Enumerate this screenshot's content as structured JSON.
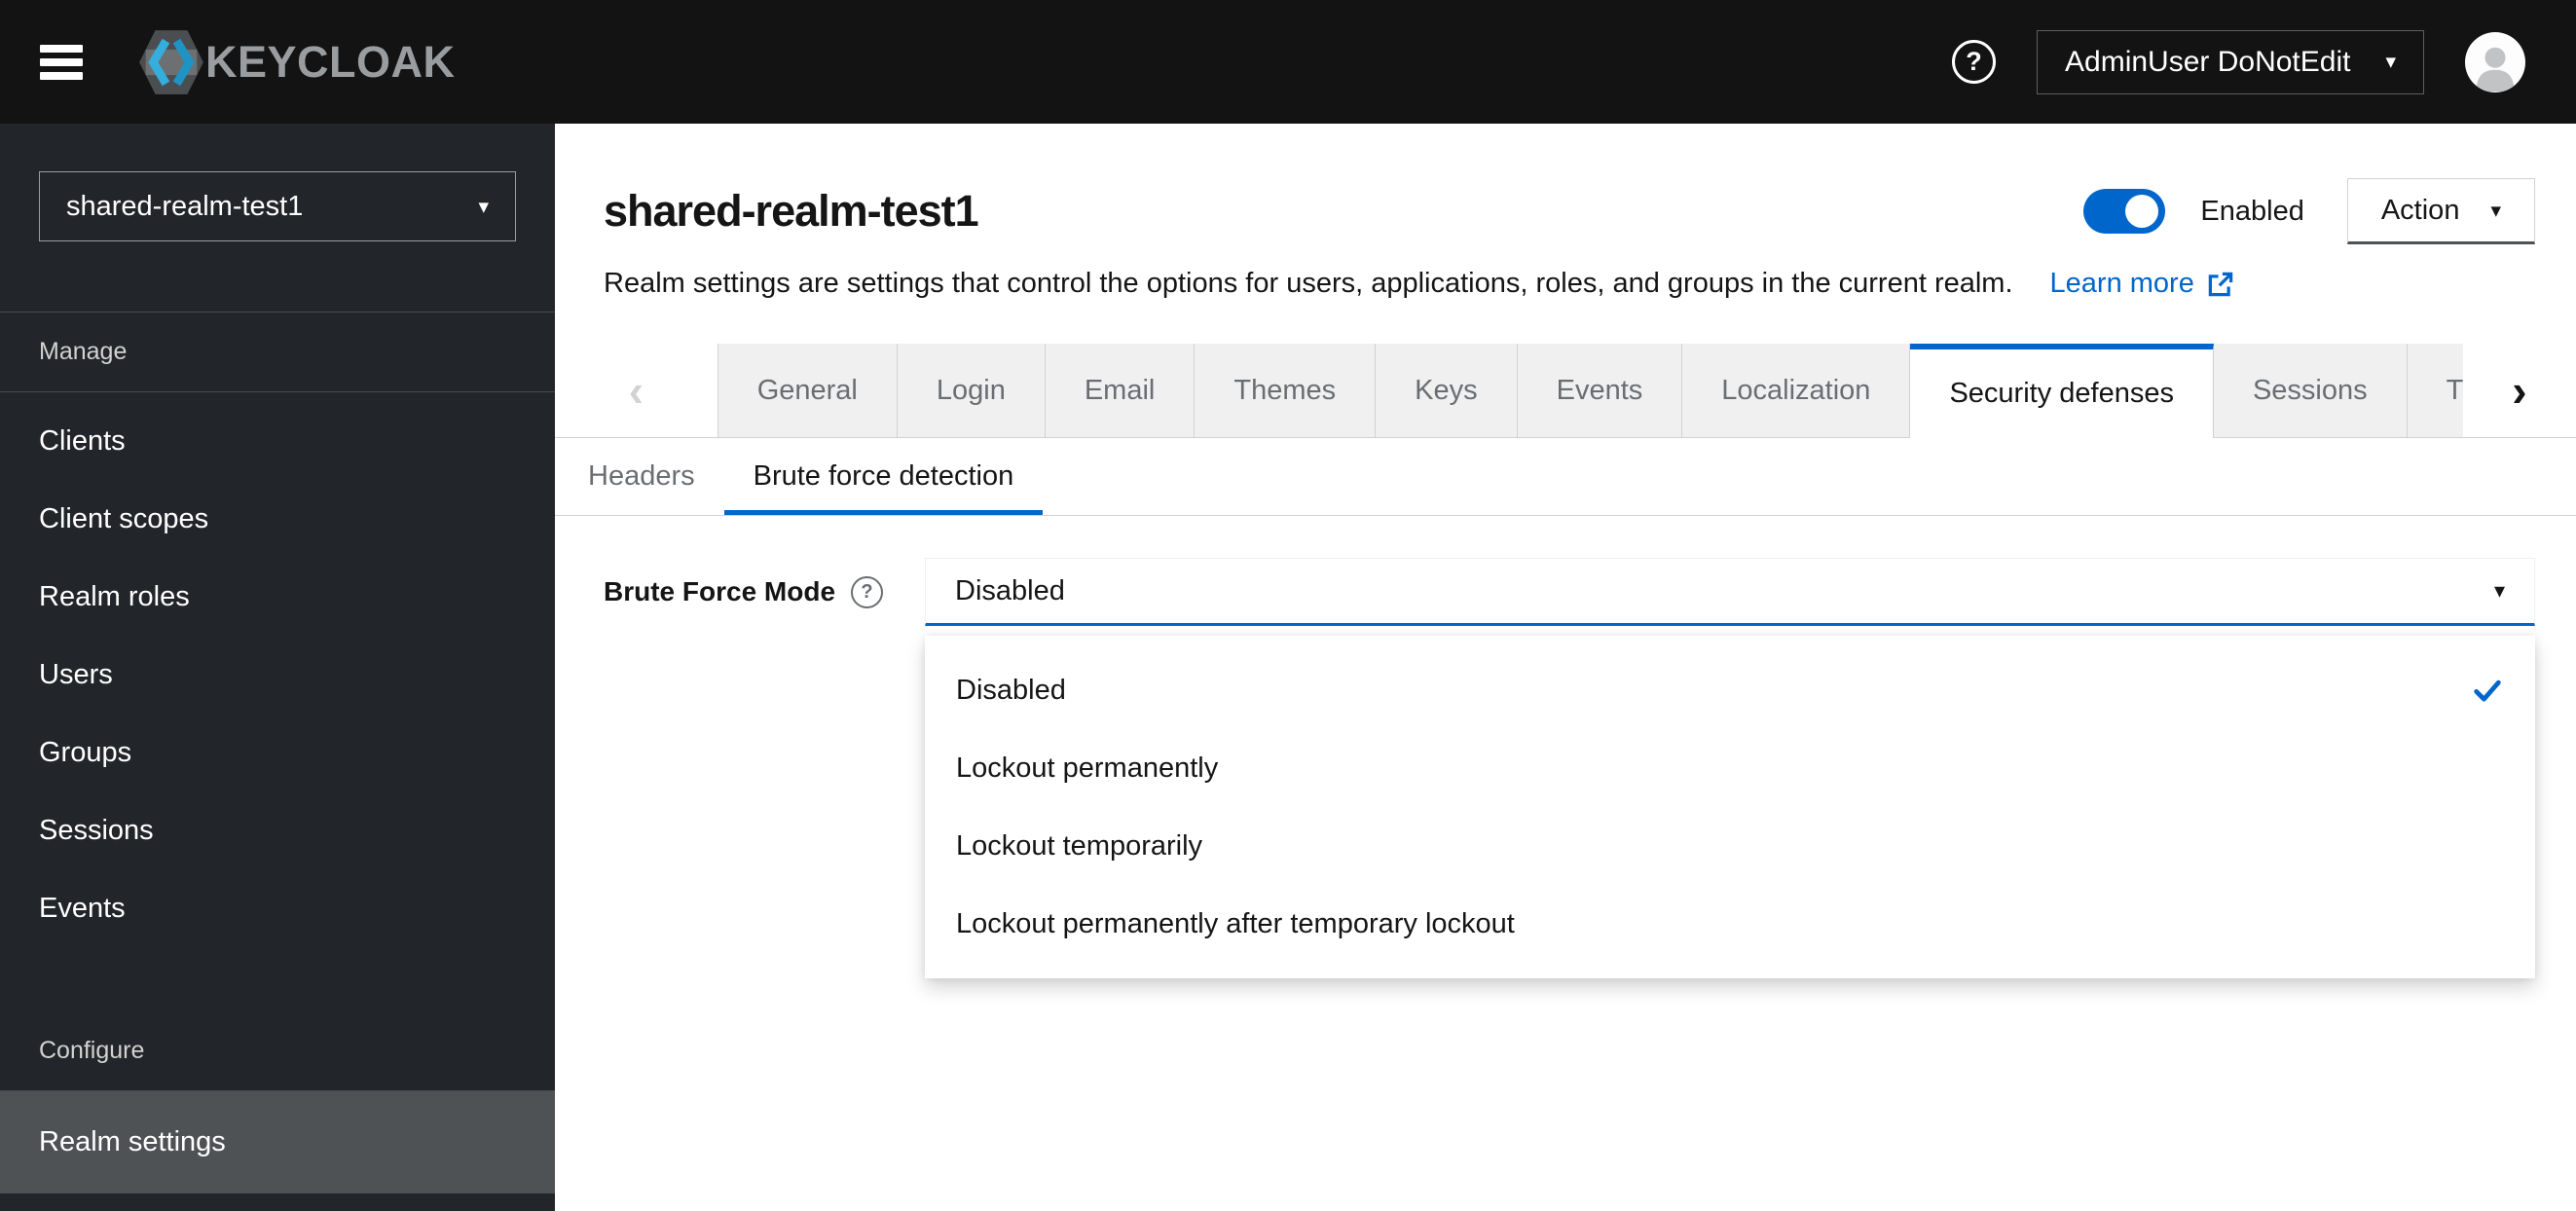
{
  "colors": {
    "accent_blue": "#0066cc",
    "masthead_bg": "#131313",
    "sidebar_bg": "#222529",
    "sidebar_active_bg": "#4f5255",
    "tab_inactive_bg": "#f0f0f0",
    "border_gray": "#d2d2d2",
    "muted_text": "#6a6e73"
  },
  "masthead": {
    "brand_text": "KEYCLOAK",
    "help_glyph": "?",
    "username": "AdminUser DoNotEdit",
    "caret_glyph": "▾"
  },
  "sidebar": {
    "realm_selector_value": "shared-realm-test1",
    "caret_glyph": "▾",
    "sections": [
      {
        "label": "Manage",
        "items": [
          "Clients",
          "Client scopes",
          "Realm roles",
          "Users",
          "Groups",
          "Sessions",
          "Events"
        ]
      },
      {
        "label": "Configure",
        "items": [
          "Realm settings"
        ]
      }
    ],
    "active_item": "Realm settings"
  },
  "page_header": {
    "title": "shared-realm-test1",
    "toggle_state": "on",
    "toggle_label": "Enabled",
    "action_label": "Action",
    "action_caret": "▾",
    "description": "Realm settings are settings that control the options for users, applications, roles, and groups in the current realm.",
    "learn_more_label": "Learn more"
  },
  "tabs": {
    "scroll_left_glyph": "‹",
    "scroll_right_glyph": "›",
    "labels": [
      "General",
      "Login",
      "Email",
      "Themes",
      "Keys",
      "Events",
      "Localization",
      "Security defenses",
      "Sessions"
    ],
    "partial_label": "T",
    "active": "Security defenses"
  },
  "subtabs": {
    "labels": [
      "Headers",
      "Brute force detection"
    ],
    "active": "Brute force detection"
  },
  "form": {
    "field_label": "Brute Force Mode",
    "help_glyph": "?",
    "select_value": "Disabled",
    "caret_glyph": "▾",
    "options": [
      "Disabled",
      "Lockout permanently",
      "Lockout temporarily",
      "Lockout permanently after temporary lockout"
    ],
    "selected_option": "Disabled"
  }
}
